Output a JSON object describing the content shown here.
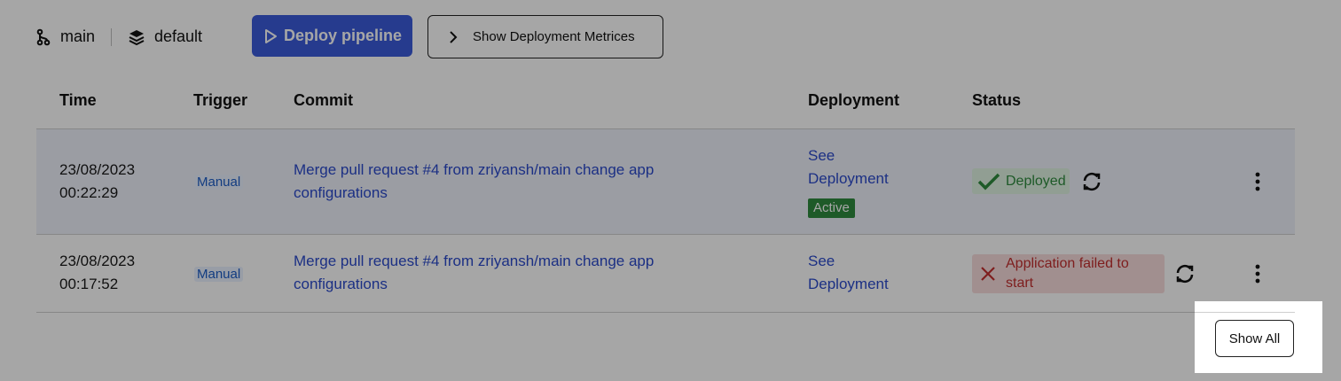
{
  "branch": {
    "icon": "git-branch-icon",
    "label": "main"
  },
  "environment": {
    "icon": "layers-icon",
    "label": "default"
  },
  "toolbar": {
    "deploy_label": "Deploy pipeline",
    "metrics_label": "Show Deployment Metrices"
  },
  "table": {
    "headers": [
      "Time",
      "Trigger",
      "Commit",
      "Deployment",
      "Status"
    ],
    "rows": [
      {
        "time": "23/08/2023",
        "time2": "00:22:29",
        "trigger": "Manual",
        "commit_line1": "Merge pull request #4 from zriyansh/main change app",
        "commit_line2": "configurations",
        "deploy_line1": "See",
        "deploy_line2": "Deployment",
        "active_badge": "Active",
        "status": "Deployed",
        "status_kind": "success"
      },
      {
        "time": "23/08/2023",
        "time2": "00:17:52",
        "trigger": "Manual",
        "commit_line1": "Merge pull request #4 from zriyansh/main change app",
        "commit_line2": "configurations",
        "deploy_line1": "See",
        "deploy_line2": "Deployment",
        "status_line1": "Application failed to",
        "status_line2": "start",
        "status_kind": "error"
      }
    ]
  },
  "footer": {
    "show_all_label": "Show All"
  },
  "colors": {
    "primary": "#3b5bdb",
    "link": "#2b4acb",
    "success": "#2e8b3e",
    "error": "#c22f2f",
    "overlay": "rgba(0,0,0,0.35)"
  }
}
